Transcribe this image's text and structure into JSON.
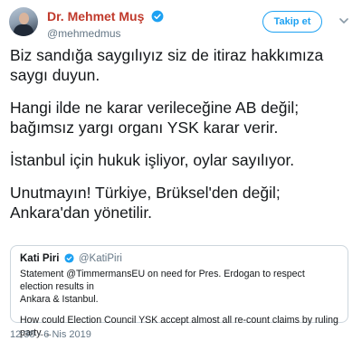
{
  "author": {
    "display_name": "Dr. Mehmet Muş",
    "handle": "@mehmedmus",
    "verified": true,
    "name_color": "#c0392b"
  },
  "follow_button": {
    "label": "Takip et"
  },
  "tweet": {
    "paragraphs": [
      "Biz sandığa saygılıyız siz de itiraz hakkımıza\nsaygı duyun.",
      "Hangi ilde ne karar verileceğine AB değil;\nbağımsız yargı organı YSK karar verir.",
      "İstanbul için hukuk işliyor, oylar sayılıyor.",
      "Unutmayın! Türkiye, Brüksel'den değil;\nAnkara'dan yönetilir."
    ]
  },
  "quoted_tweet": {
    "name": "Kati Piri",
    "handle": "@KatiPiri",
    "verified": true,
    "text_1": "Statement @TimmermansEU on need for Pres. Erdogan to respect election results in\nAnkara & Istanbul.",
    "text_2": "How could Election Council YSK accept almost all re-count claims by ruling party...."
  },
  "timestamp": "12:38 - 6 Nis 2019",
  "colors": {
    "accent": "#1da1f2",
    "muted": "#657786",
    "border": "#cdd6dd"
  },
  "icons": [
    "verified-badge-icon",
    "chevron-down-icon"
  ]
}
